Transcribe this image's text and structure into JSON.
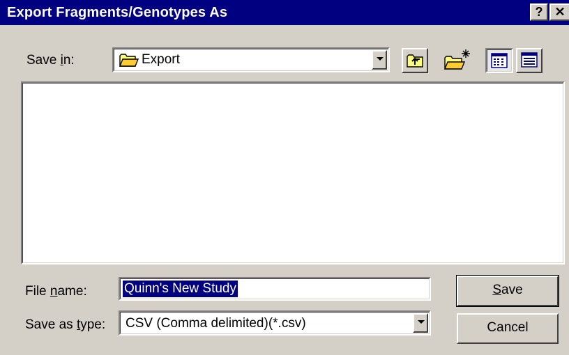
{
  "window": {
    "title": "Export Fragments/Genotypes As",
    "help_glyph": "?",
    "close_glyph": "✕"
  },
  "save_in": {
    "label_pre": "Save ",
    "label_underline": "i",
    "label_post": "n:",
    "value": "Export",
    "icon": "folder-icon"
  },
  "toolbar": {
    "icons": [
      "up-one-level-icon",
      "create-new-folder-icon",
      "list-view-icon",
      "details-view-icon"
    ]
  },
  "file_name": {
    "label_pre": "File ",
    "label_underline": "n",
    "label_post": "ame:",
    "value": "Quinn's New Study"
  },
  "save_as_type": {
    "label_pre": "Save as ",
    "label_underline": "t",
    "label_post": "ype:",
    "value": "CSV (Comma delimited)(*.csv)"
  },
  "buttons": {
    "save_underline": "S",
    "save_rest": "ave",
    "cancel": "Cancel"
  },
  "colors": {
    "title_bar": "#000080",
    "face": "#d4d0c8",
    "selection": "#000080"
  }
}
